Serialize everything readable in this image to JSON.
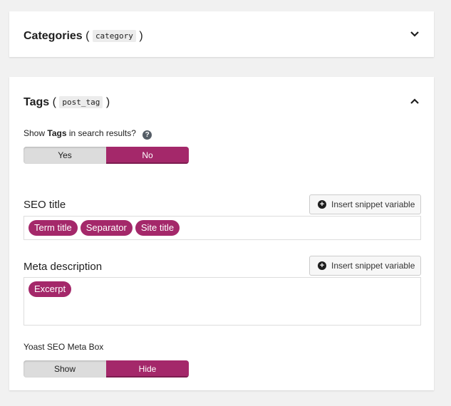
{
  "categories_panel": {
    "title": "Categories",
    "open_paren": "(",
    "taxonomy_code": "category",
    "close_paren": ")"
  },
  "tags_panel": {
    "title": "Tags",
    "open_paren": "(",
    "taxonomy_code": "post_tag",
    "close_paren": ")",
    "search_label_prefix": "Show",
    "search_label_bold": "Tags",
    "search_label_suffix": "in search results?",
    "help_glyph": "?",
    "search_toggle": {
      "yes": "Yes",
      "no": "No",
      "selected": "No"
    },
    "seo_title_label": "SEO title",
    "insert_snippet_label": "Insert snippet variable",
    "seo_title_variables": [
      "Term title",
      "Separator",
      "Site title"
    ],
    "meta_description_label": "Meta description",
    "meta_description_variables": [
      "Excerpt"
    ],
    "meta_box_label": "Yoast SEO Meta Box",
    "meta_box_toggle": {
      "show": "Show",
      "hide": "Hide",
      "selected": "Hide"
    }
  },
  "colors": {
    "accent": "#a4286a",
    "background": "#f1f1f1",
    "panel": "#ffffff"
  },
  "icons": [
    "chevron-down-icon",
    "chevron-up-icon",
    "help-icon",
    "plus-circle-icon"
  ]
}
